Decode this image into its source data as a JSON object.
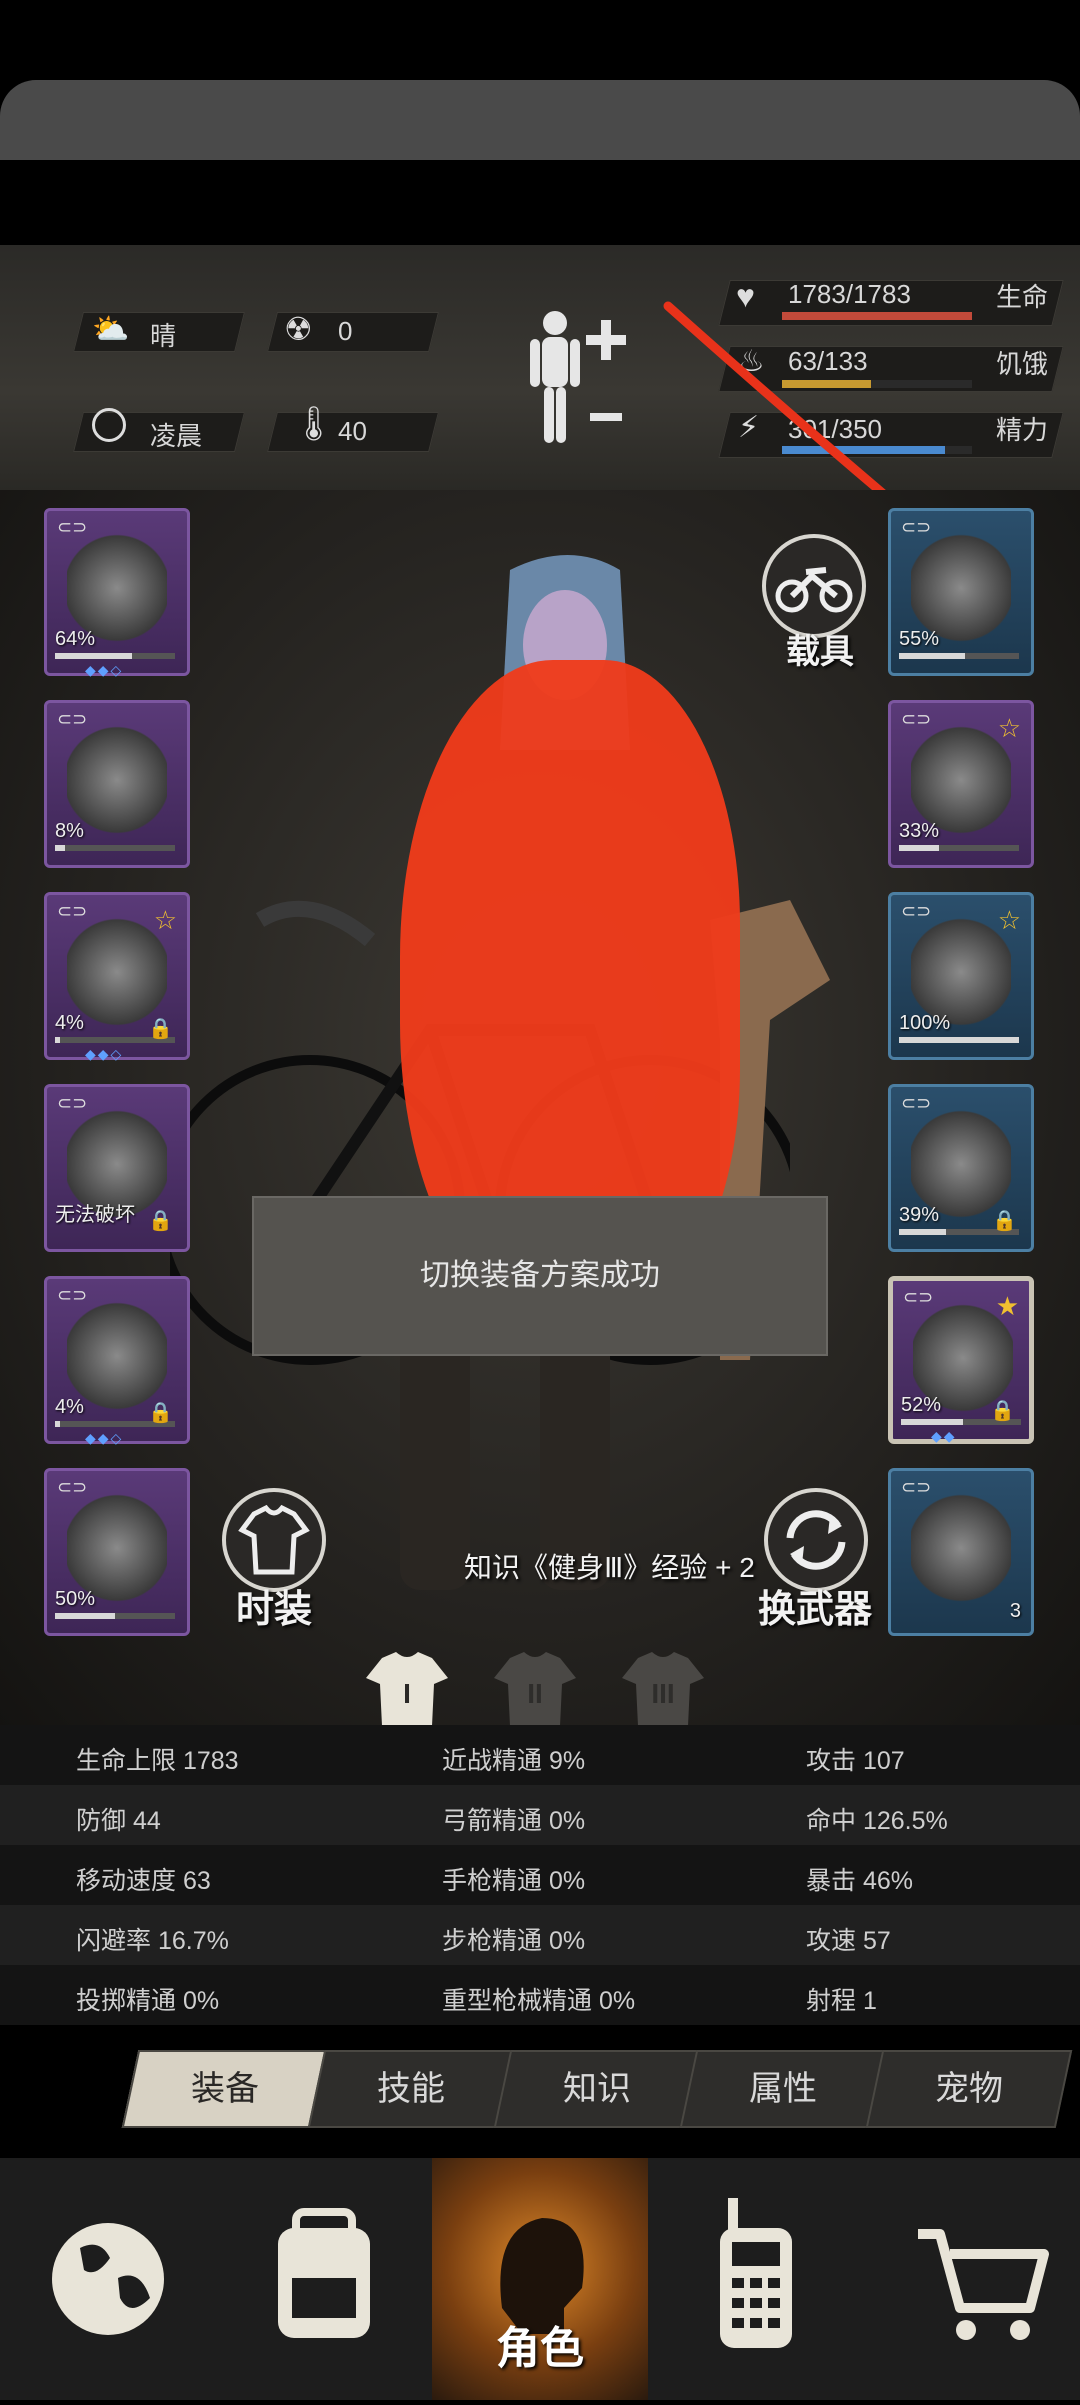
{
  "hud": {
    "weather": "晴",
    "radiation": "0",
    "time_of_day": "凌晨",
    "temperature": "40",
    "stats": [
      {
        "value": "1783/1783",
        "label": "生命",
        "fill": 1.0,
        "color": "#c24a3a"
      },
      {
        "value": "63/133",
        "label": "饥饿",
        "fill": 0.47,
        "color": "#c89a30"
      },
      {
        "value": "301/350",
        "label": "精力",
        "fill": 0.86,
        "color": "#4a8ad0"
      }
    ]
  },
  "left_slots": [
    {
      "name": "helmet",
      "pct": "64%",
      "fill": 0.64,
      "color": "purple"
    },
    {
      "name": "shirt",
      "pct": "8%",
      "fill": 0.08,
      "color": "purple"
    },
    {
      "name": "jacket",
      "pct": "4%",
      "fill": 0.04,
      "color": "purple"
    },
    {
      "name": "backpack",
      "pct": "无法破坏",
      "fill": 0,
      "color": "purple"
    },
    {
      "name": "pants",
      "pct": "4%",
      "fill": 0.04,
      "color": "purple"
    },
    {
      "name": "boots",
      "pct": "50%",
      "fill": 0.5,
      "color": "purple"
    }
  ],
  "right_slots": [
    {
      "name": "glasses",
      "pct": "55%",
      "fill": 0.55,
      "color": "blue"
    },
    {
      "name": "gas-mask",
      "pct": "33%",
      "fill": 0.33,
      "color": "purple"
    },
    {
      "name": "vest",
      "pct": "100%",
      "fill": 1.0,
      "color": "blue"
    },
    {
      "name": "shield",
      "pct": "39%",
      "fill": 0.39,
      "color": "blue"
    },
    {
      "name": "machete",
      "pct": "52%",
      "fill": 0.52,
      "color": "gold"
    },
    {
      "name": "molotov",
      "pct": "3",
      "fill": 0,
      "color": "blue"
    }
  ],
  "buttons": {
    "vehicle": "载具",
    "costume": "时装",
    "switch_weapon": "换武器"
  },
  "toast": "切换装备方案成功",
  "knowledge_msg": "知识《健身Ⅲ》经验 + 2",
  "outfit_tabs": [
    "I",
    "II",
    "III"
  ],
  "stats_rows": [
    [
      "生命上限 1783",
      "近战精通 9%",
      "攻击 107"
    ],
    [
      "防御 44",
      "弓箭精通 0%",
      "命中 126.5%"
    ],
    [
      "移动速度 63",
      "手枪精通 0%",
      "暴击 46%"
    ],
    [
      "闪避率 16.7%",
      "步枪精通 0%",
      "攻速 57"
    ],
    [
      "投掷精通 0%",
      "重型枪械精通 0%",
      "射程 1"
    ]
  ],
  "tabs": [
    "装备",
    "技能",
    "知识",
    "属性",
    "宠物"
  ],
  "active_tab": 0,
  "bottom_nav": {
    "items": [
      "globe-icon",
      "backpack-icon",
      "character-icon",
      "radio-icon",
      "cart-icon"
    ],
    "active_label": "角色"
  }
}
